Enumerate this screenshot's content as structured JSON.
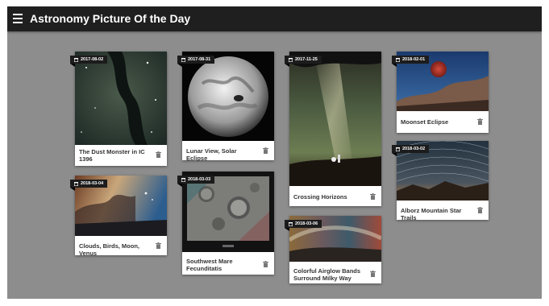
{
  "app": {
    "title": "Astronomy Picture Of the Day",
    "icons": {
      "menu": "menu-icon",
      "date": "calendar-icon",
      "delete": "trash-icon"
    }
  },
  "cards": [
    {
      "date": "2017-08-02",
      "caption": "The Dust Monster in IC 1396"
    },
    {
      "date": "2018-03-04",
      "caption": "Clouds, Birds, Moon, Venus"
    },
    {
      "date": "2017-08-31",
      "caption": "Lunar View, Solar Eclipse"
    },
    {
      "date": "2018-03-03",
      "caption": "Southwest Mare Fecunditatis"
    },
    {
      "date": "2017-11-25",
      "caption": "Crossing Horizons"
    },
    {
      "date": "2018-03-06",
      "caption": "Colorful Airglow Bands Surround Milky Way"
    },
    {
      "date": "2018-02-01",
      "caption": "Moonset Eclipse"
    },
    {
      "date": "2018-03-02",
      "caption": "Alborz Mountain Star Trails"
    }
  ]
}
